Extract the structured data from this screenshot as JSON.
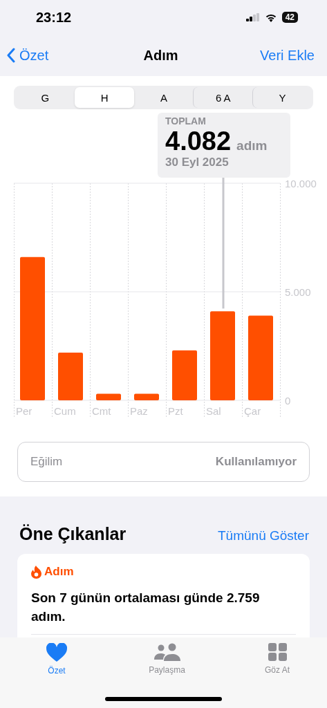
{
  "status_bar": {
    "time": "23:12",
    "battery": "42"
  },
  "nav": {
    "back": "Özet",
    "title": "Adım",
    "action": "Veri Ekle"
  },
  "segments": [
    {
      "label": "G",
      "selected": false
    },
    {
      "label": "H",
      "selected": true
    },
    {
      "label": "A",
      "selected": false
    },
    {
      "label": "6 A",
      "selected": false
    },
    {
      "label": "Y",
      "selected": false
    }
  ],
  "tooltip": {
    "label": "TOPLAM",
    "value": "4.082",
    "unit": "adım",
    "date": "30 Eyl 2025"
  },
  "chart_data": {
    "type": "bar",
    "categories": [
      "Per",
      "Cum",
      "Cmt",
      "Paz",
      "Pzt",
      "Sal",
      "Çar"
    ],
    "series": [
      {
        "color": "#ff4f00",
        "values": [
          6600,
          2200,
          300,
          300,
          2300,
          4100,
          3900
        ]
      }
    ],
    "ylim": [
      0,
      10000
    ],
    "yticks": [
      {
        "value": 0,
        "label": "0"
      },
      {
        "value": 5000,
        "label": "5.000"
      },
      {
        "value": 10000,
        "label": "10.000"
      }
    ]
  },
  "trend": {
    "label": "Eğilim",
    "value": "Kullanılamıyor"
  },
  "highlights": {
    "title": "Öne Çıkanlar",
    "link": "Tümünü Göster",
    "cards": [
      {
        "category": "Adım",
        "text": "Son 7 günün ortalaması günde 2.759 adım."
      }
    ]
  },
  "tab_bar": [
    {
      "kind": "heart",
      "label": "Özet",
      "selected": true
    },
    {
      "kind": "people",
      "label": "Paylaşma",
      "selected": false
    },
    {
      "kind": "grid",
      "label": "Göz At",
      "selected": false
    }
  ]
}
